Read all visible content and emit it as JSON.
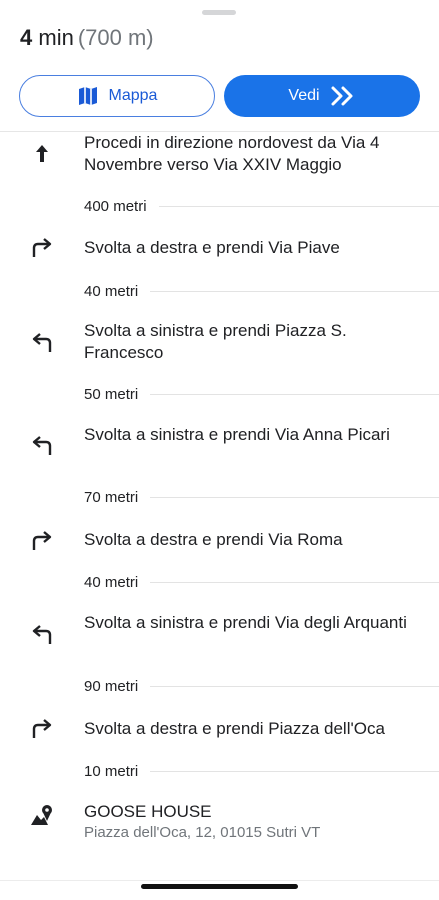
{
  "summary": {
    "time_value": "4",
    "time_unit": "min",
    "distance": "(700 m)"
  },
  "buttons": {
    "map_label": "Mappa",
    "go_label": "Vedi"
  },
  "steps": [
    {
      "icon": "arrow-straight-icon",
      "text": "Procedi in direzione nordovest da Via 4 Novembre verso Via XXIV Maggio",
      "distance": "400 metri"
    },
    {
      "icon": "turn-right-icon",
      "text": "Svolta a destra e prendi Via Piave",
      "distance": "40 metri"
    },
    {
      "icon": "turn-left-icon",
      "text": "Svolta a sinistra e prendi Piazza S. Francesco",
      "distance": "50 metri"
    },
    {
      "icon": "turn-left-icon",
      "text": "Svolta a sinistra e prendi Via Anna Picari",
      "distance": "70 metri"
    },
    {
      "icon": "turn-right-icon",
      "text": "Svolta a destra e prendi Via Roma",
      "distance": "40 metri"
    },
    {
      "icon": "turn-left-icon",
      "text": "Svolta a sinistra e prendi Via degli Arquanti",
      "distance": "90 metri"
    },
    {
      "icon": "turn-right-icon",
      "text": "Svolta a destra e prendi Piazza dell'Oca",
      "distance": "10 metri"
    }
  ],
  "destination": {
    "icon": "destination-icon",
    "name": "GOOSE HOUSE",
    "address": "Piazza dell'Oca, 12, 01015 Sutri VT"
  },
  "colors": {
    "accent": "#1a73e8",
    "text": "#202124",
    "secondary": "#70757a"
  }
}
